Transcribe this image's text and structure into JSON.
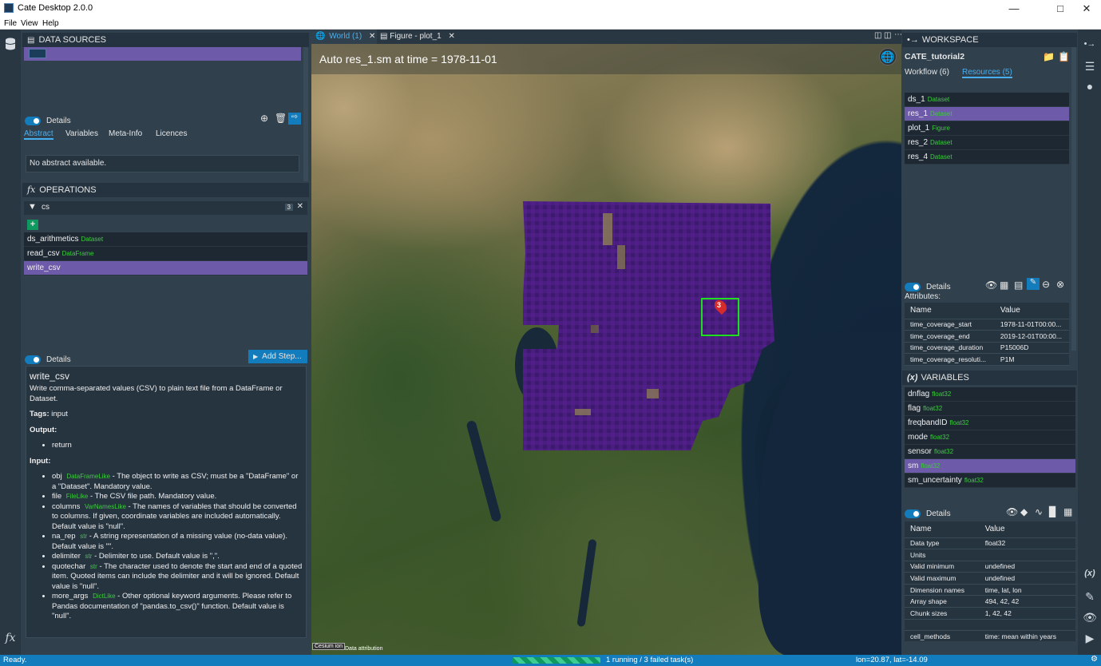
{
  "app": {
    "title": "Cate Desktop 2.0.0"
  },
  "menu": [
    "File",
    "View",
    "Help"
  ],
  "data_sources": {
    "header": "DATA SOURCES",
    "details_label": "Details",
    "tabs": [
      "Abstract",
      "Variables",
      "Meta-Info",
      "Licences"
    ],
    "abstract": "No abstract available."
  },
  "operations": {
    "header": "OPERATIONS",
    "filter_value": "cs",
    "filter_count": "3",
    "add_label": "+",
    "items": [
      {
        "name": "ds_arithmetics",
        "type": "Dataset",
        "selected": false
      },
      {
        "name": "read_csv",
        "type": "DataFrame",
        "selected": false
      },
      {
        "name": "write_csv",
        "type": "",
        "selected": true
      }
    ],
    "details_label": "Details",
    "add_step_label": "Add Step...",
    "doc": {
      "title": "write_csv",
      "description": "Write comma-separated values (CSV) to plain text file from a DataFrame or Dataset.",
      "tags_label": "Tags:",
      "tags_value": "input",
      "output_label": "Output:",
      "output_item": "return",
      "input_label": "Input:",
      "inputs": [
        {
          "name": "obj",
          "type": "DataFrameLike",
          "desc": "- The object to write as CSV; must be a \"DataFrame\" or a \"Dataset\". Mandatory value."
        },
        {
          "name": "file",
          "type": "FileLike",
          "desc": "- The CSV file path. Mandatory value."
        },
        {
          "name": "columns",
          "type": "VarNamesLike",
          "desc": "- The names of variables that should be converted to columns. If given, coordinate variables are included automatically. Default value is \"null\"."
        },
        {
          "name": "na_rep",
          "type": "str",
          "desc": "- A string representation of a missing value (no-data value). Default value is \"\"."
        },
        {
          "name": "delimiter",
          "type": "str",
          "desc": "- Delimiter to use. Default value is \",\"."
        },
        {
          "name": "quotechar",
          "type": "str",
          "desc": "- The character used to denote the start and end of a quoted item. Quoted items can include the delimiter and it will be ignored. Default value is \"null\"."
        },
        {
          "name": "more_args",
          "type": "DictLike",
          "desc": "- Other optional keyword arguments. Please refer to Pandas documentation of \"pandas.to_csv()\" function. Default value is \"null\"."
        }
      ]
    }
  },
  "views": {
    "tabs": [
      {
        "label": "World (1)",
        "icon": "globe-icon",
        "active": true
      },
      {
        "label": "Figure - plot_1",
        "icon": "chart-icon",
        "active": false
      }
    ],
    "map_title": "Auto res_1.sm at time = 1978-11-01",
    "marker_label": "3",
    "cesium_logo": "Cesium ion",
    "attribution": "Data attribution"
  },
  "workspace": {
    "header": "WORKSPACE",
    "name": "CATE_tutorial2",
    "tabs": [
      "Workflow (6)",
      "Resources (5)"
    ],
    "resources": [
      {
        "name": "ds_1",
        "type": "Dataset",
        "selected": false
      },
      {
        "name": "res_1",
        "type": "Dataset",
        "selected": true
      },
      {
        "name": "plot_1",
        "type": "Figure",
        "selected": false
      },
      {
        "name": "res_2",
        "type": "Dataset",
        "selected": false
      },
      {
        "name": "res_4",
        "type": "Dataset",
        "selected": false
      }
    ],
    "details_label": "Details",
    "attributes_label": "Attributes:",
    "attr_cols": [
      "Name",
      "Value"
    ],
    "attributes": [
      [
        "time_coverage_start",
        "1978-11-01T00:00..."
      ],
      [
        "time_coverage_end",
        "2019-12-01T00:00..."
      ],
      [
        "time_coverage_duration",
        "P15006D"
      ],
      [
        "time_coverage_resoluti...",
        "P1M"
      ]
    ]
  },
  "variables": {
    "header": "VARIABLES",
    "items": [
      {
        "name": "dnflag",
        "type": "float32",
        "selected": false
      },
      {
        "name": "flag",
        "type": "float32",
        "selected": false
      },
      {
        "name": "freqbandID",
        "type": "float32",
        "selected": false
      },
      {
        "name": "mode",
        "type": "float32",
        "selected": false
      },
      {
        "name": "sensor",
        "type": "float32",
        "selected": false
      },
      {
        "name": "sm",
        "type": "float32",
        "selected": true
      },
      {
        "name": "sm_uncertainty",
        "type": "float32",
        "selected": false
      }
    ],
    "details_label": "Details",
    "cols": [
      "Name",
      "Value"
    ],
    "props": [
      [
        "Data type",
        "float32"
      ],
      [
        "Units",
        ""
      ],
      [
        "Valid minimum",
        "undefined"
      ],
      [
        "Valid maximum",
        "undefined"
      ],
      [
        "Dimension names",
        "time, lat, lon"
      ],
      [
        "Array shape",
        "494, 42, 42"
      ],
      [
        "Chunk sizes",
        "1, 42, 42"
      ],
      [
        "",
        ""
      ],
      [
        "cell_methods",
        "time: mean within years"
      ]
    ]
  },
  "status": {
    "left": "Ready.",
    "tasks": "1 running / 3 failed task(s)",
    "coords": "lon=20.87, lat=-14.09"
  },
  "colors": {
    "accent": "#137cbd",
    "selection": "#6d5aa8",
    "status_bar": "#137cbd",
    "type_tag": "#3dcc3d"
  }
}
